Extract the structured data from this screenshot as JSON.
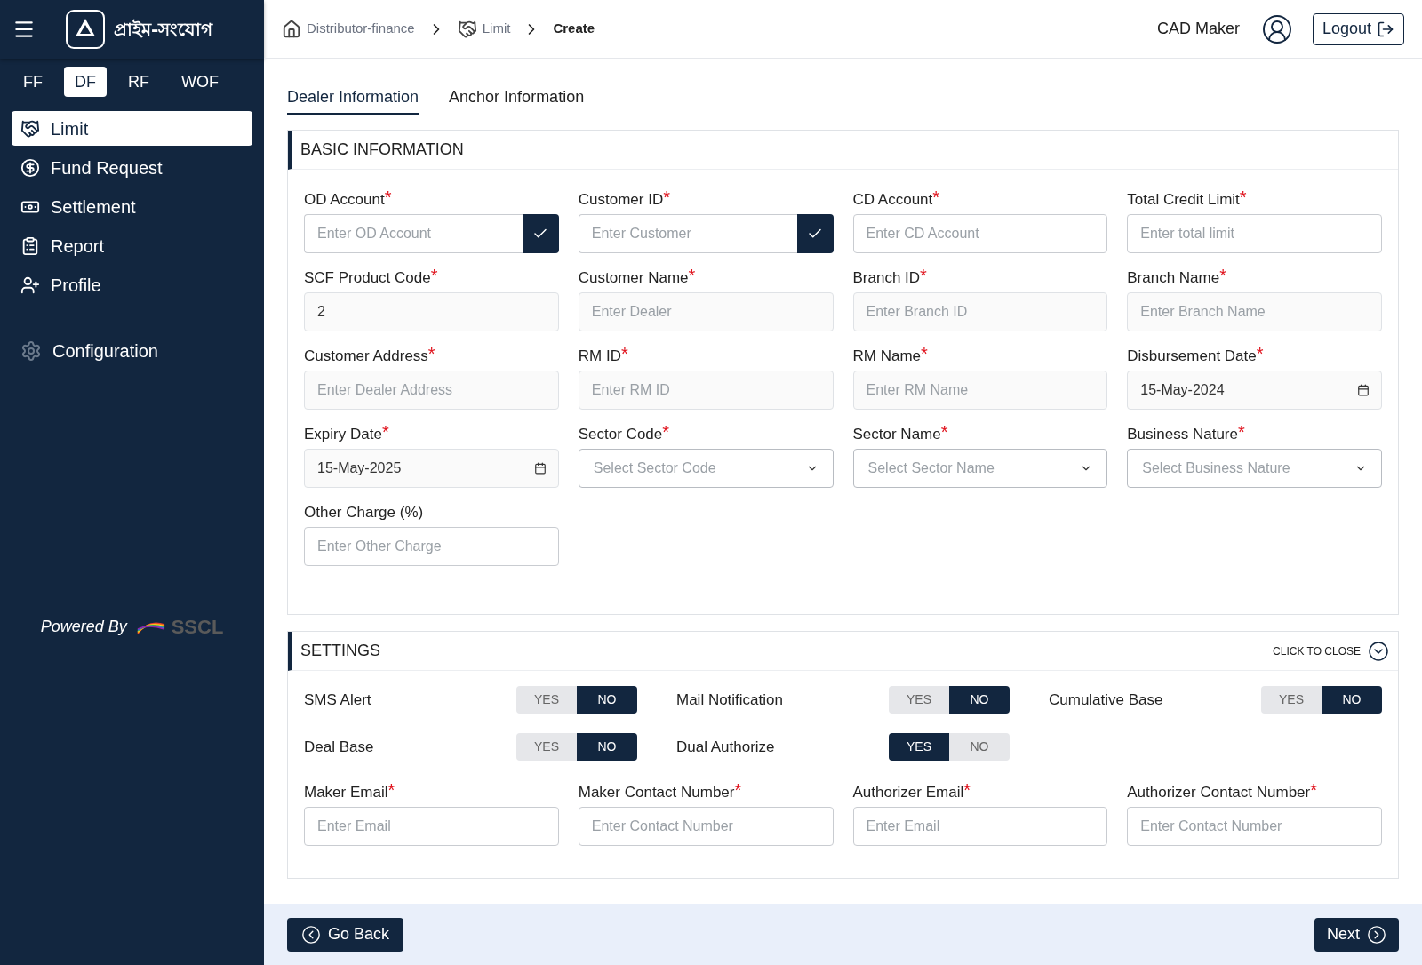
{
  "sidebar": {
    "brand": "প্রাইম-সংযোগ",
    "modules": [
      {
        "label": "FF",
        "selected": false
      },
      {
        "label": "DF",
        "selected": true
      },
      {
        "label": "RF",
        "selected": false
      },
      {
        "label": "WOF",
        "selected": false
      }
    ],
    "items": [
      {
        "label": "Limit",
        "selected": true
      },
      {
        "label": "Fund Request",
        "selected": false
      },
      {
        "label": "Settlement",
        "selected": false
      },
      {
        "label": "Report",
        "selected": false
      },
      {
        "label": "Profile",
        "selected": false
      }
    ],
    "config": {
      "label": "Configuration"
    },
    "powered_by": "Powered By",
    "powered_logo": "SSCL"
  },
  "header": {
    "breadcrumb": [
      {
        "label": "Distributor-finance"
      },
      {
        "label": "Limit"
      },
      {
        "label": "Create"
      }
    ],
    "user": "CAD Maker",
    "logout": "Logout"
  },
  "tabs": [
    {
      "label": "Dealer Information",
      "selected": true
    },
    {
      "label": "Anchor Information",
      "selected": false
    }
  ],
  "basic": {
    "title": "BASIC INFORMATION",
    "fields": [
      {
        "label": "OD Account",
        "required_mark": "*",
        "kind": "check",
        "placeholder": "Enter OD Account",
        "disabled": false
      },
      {
        "label": "Customer ID",
        "required_mark": "*",
        "kind": "check",
        "placeholder": "Enter Customer",
        "disabled": false
      },
      {
        "label": "CD Account",
        "required_mark": "*",
        "kind": "text",
        "placeholder": "Enter CD Account",
        "disabled": false
      },
      {
        "label": "Total Credit Limit",
        "required_mark": "*",
        "kind": "text",
        "placeholder": "Enter total limit",
        "disabled": false
      },
      {
        "label": "SCF Product Code",
        "required_mark": "*",
        "kind": "text",
        "value": "2",
        "disabled": true
      },
      {
        "label": "Customer Name",
        "required_mark": "*",
        "kind": "text",
        "placeholder": "Enter Dealer",
        "disabled": true
      },
      {
        "label": "Branch ID",
        "required_mark": "*",
        "kind": "text",
        "placeholder": "Enter Branch ID",
        "disabled": true
      },
      {
        "label": "Branch Name",
        "required_mark": "*",
        "kind": "text",
        "placeholder": "Enter Branch Name",
        "disabled": true
      },
      {
        "label": "Customer Address",
        "required_mark": "*",
        "kind": "text",
        "placeholder": "Enter Dealer Address",
        "disabled": true
      },
      {
        "label": "RM ID",
        "required_mark": "*",
        "kind": "text",
        "placeholder": "Enter RM ID",
        "disabled": true
      },
      {
        "label": "RM Name",
        "required_mark": "*",
        "kind": "text",
        "placeholder": "Enter RM Name",
        "disabled": true
      },
      {
        "label": "Disbursement Date",
        "required_mark": "*",
        "kind": "date",
        "value": "15-May-2024",
        "disabled": true
      },
      {
        "label": "Expiry Date",
        "required_mark": "*",
        "kind": "date",
        "value": "15-May-2025",
        "disabled": true
      },
      {
        "label": "Sector Code",
        "required_mark": "*",
        "kind": "select",
        "placeholder": "Select Sector Code"
      },
      {
        "label": "Sector Name",
        "required_mark": "*",
        "kind": "select",
        "placeholder": "Select Sector Name"
      },
      {
        "label": "Business Nature",
        "required_mark": "*",
        "kind": "select",
        "placeholder": "Select Business Nature"
      },
      {
        "label": "Other Charge (%)",
        "kind": "text",
        "placeholder": "Enter Other Charge",
        "disabled": false
      }
    ]
  },
  "settings": {
    "title": "SETTINGS",
    "close_label": "CLICK TO CLOSE",
    "toggles": [
      {
        "label": "SMS Alert",
        "options": [
          {
            "label": "YES",
            "selected": false
          },
          {
            "label": "NO",
            "selected": true
          }
        ]
      },
      {
        "label": "Mail Notification",
        "options": [
          {
            "label": "YES",
            "selected": false
          },
          {
            "label": "NO",
            "selected": true
          }
        ]
      },
      {
        "label": "Cumulative Base",
        "options": [
          {
            "label": "YES",
            "selected": false
          },
          {
            "label": "NO",
            "selected": true
          }
        ]
      },
      {
        "label": "Deal Base",
        "options": [
          {
            "label": "YES",
            "selected": false
          },
          {
            "label": "NO",
            "selected": true
          }
        ]
      },
      {
        "label": "Dual Authorize",
        "options": [
          {
            "label": "YES",
            "selected": true
          },
          {
            "label": "NO",
            "selected": false
          }
        ]
      }
    ],
    "fields": [
      {
        "label": "Maker Email",
        "required_mark": "*",
        "kind": "text",
        "placeholder": "Enter Email",
        "disabled": false
      },
      {
        "label": "Maker Contact Number",
        "required_mark": "*",
        "kind": "text",
        "placeholder": "Enter Contact Number",
        "disabled": false
      },
      {
        "label": "Authorizer Email",
        "required_mark": "*",
        "kind": "text",
        "placeholder": "Enter Email",
        "disabled": false
      },
      {
        "label": "Authorizer Contact Number",
        "required_mark": "*",
        "kind": "text",
        "placeholder": "Enter Contact Number",
        "disabled": false
      }
    ]
  },
  "footer": {
    "back": "Go Back",
    "next": "Next"
  }
}
